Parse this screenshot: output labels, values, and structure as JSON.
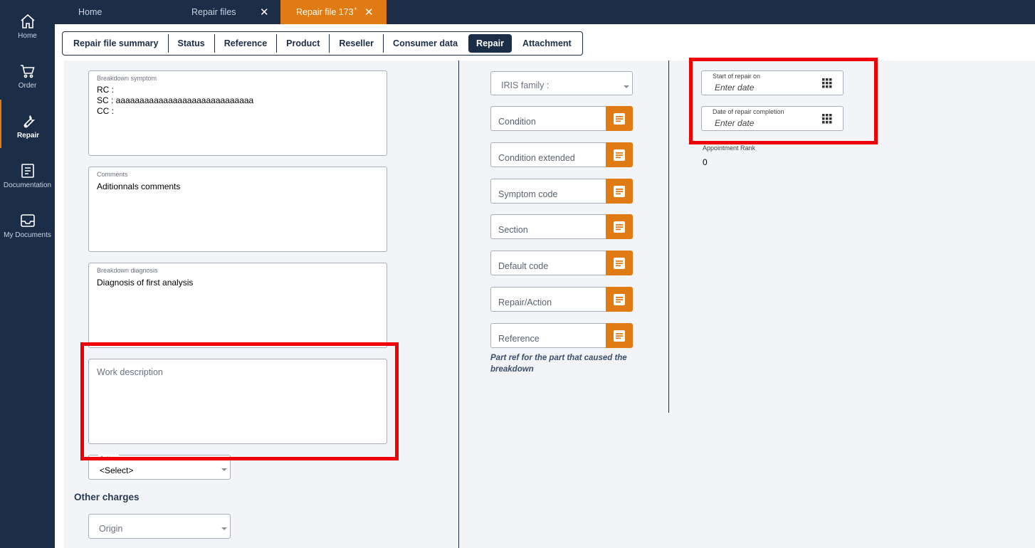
{
  "sidebar": {
    "items": [
      {
        "label": "Home",
        "icon": "home-icon"
      },
      {
        "label": "Order",
        "icon": "cart-icon"
      },
      {
        "label": "Repair",
        "icon": "wrench-icon",
        "active": true
      },
      {
        "label": "Documentation",
        "icon": "document-icon"
      },
      {
        "label": "My Documents",
        "icon": "inbox-icon"
      }
    ]
  },
  "tabs": {
    "home": "Home",
    "repair_files": "Repair files",
    "repair_file": "Repair file 173",
    "modified_mark": "*",
    "close": "✕"
  },
  "subnav": {
    "items": [
      "Repair file summary",
      "Status",
      "Reference",
      "Product",
      "Reseller",
      "Consumer data",
      "Repair",
      "Attachment"
    ],
    "active": "Repair"
  },
  "left": {
    "breakdown_symptom": {
      "label": "Breakdown symptom",
      "value": "RC :\nSC : aaaaaaaaaaaaaaaaaaaaaaaaaaaaa\nCC :"
    },
    "comments": {
      "label": "Comments",
      "value": "Aditionnals comments"
    },
    "breakdown_diagnosis": {
      "label": "Breakdown diagnosis",
      "value": "Diagnosis of first analysis"
    },
    "work_description": {
      "placeholder": "Work description"
    },
    "action": {
      "label": "Action",
      "value": "<Select>"
    },
    "other_charges_title": "Other charges",
    "origin": {
      "placeholder": "Origin"
    }
  },
  "middle": {
    "iris_family": "IRIS family :",
    "fields": [
      "Condition",
      "Condition extended",
      "Symptom code",
      "Section",
      "Default code",
      "Repair/Action",
      "Reference"
    ],
    "reference_hint": "Part ref for the part that caused the breakdown"
  },
  "right": {
    "start_of_repair": {
      "label": "Start of repair on",
      "placeholder": "Enter date"
    },
    "repair_completion": {
      "label": "Date of repair completion",
      "placeholder": "Enter date"
    },
    "appointment_rank_label": "Appointment Rank",
    "appointment_rank_value": "0"
  },
  "colors": {
    "navy": "#1c2d47",
    "accent_orange": "#e07b14",
    "highlight_red": "#ee0000"
  }
}
